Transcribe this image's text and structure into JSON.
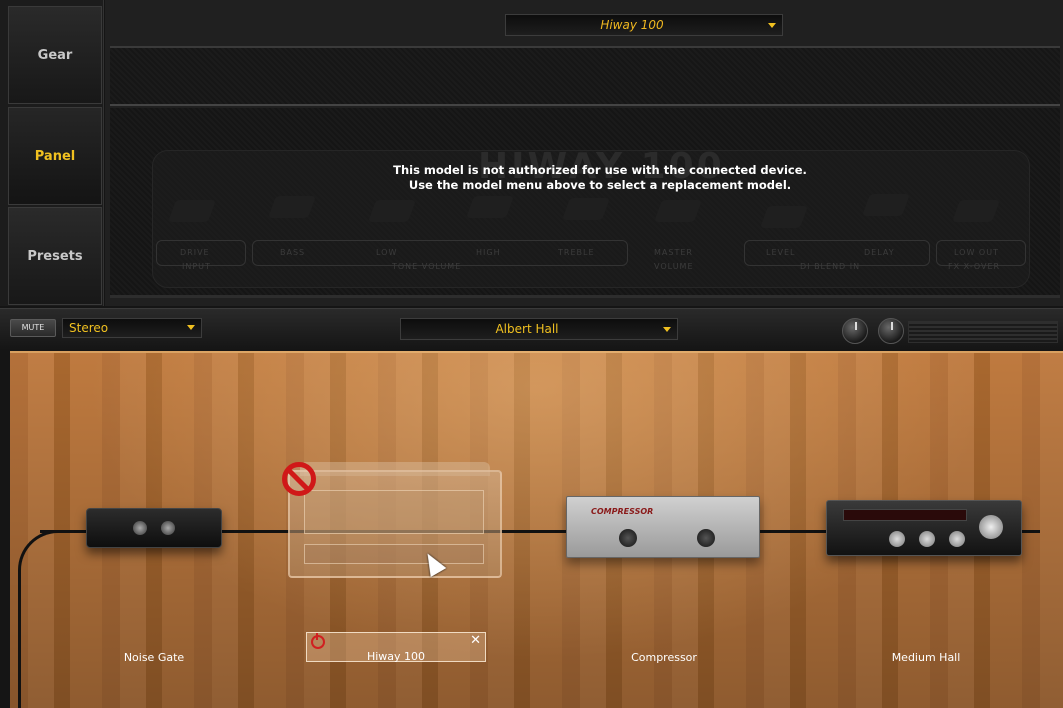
{
  "sidebar": {
    "items": [
      {
        "label": "Gear"
      },
      {
        "label": "Panel"
      },
      {
        "label": "Presets"
      }
    ]
  },
  "amp": {
    "model_select": "Hiway 100",
    "brand": "HIWAY 100",
    "notice_line1": "This model is not authorized for use with the connected device.",
    "notice_line2": "Use the model menu above to select a replacement model.",
    "controls": {
      "drive": "DRIVE",
      "input": "INPUT",
      "bass": "BASS",
      "low": "LOW",
      "high": "HIGH",
      "treble": "TREBLE",
      "tone_volume": "TONE VOLUME",
      "master": "MASTER",
      "volume": "VOLUME",
      "level": "LEVEL",
      "delay": "DELAY",
      "di_blend_in": "DI BLEND IN",
      "low_out": "LOW OUT",
      "fx_xover": "FX X-OVER"
    }
  },
  "toolbar": {
    "mute_label": "MUTE",
    "output_mode": "Stereo",
    "room_select": "Albert Hall"
  },
  "chain": {
    "slots": [
      {
        "label": "Noise Gate"
      },
      {
        "label": "Hiway 100"
      },
      {
        "label": "Compressor"
      },
      {
        "label": "Medium Hall"
      }
    ],
    "compressor_plate": "COMPRESSOR"
  },
  "colors": {
    "accent": "#f0c020",
    "stage_wood": "#b87540",
    "warning_red": "#d01818"
  }
}
